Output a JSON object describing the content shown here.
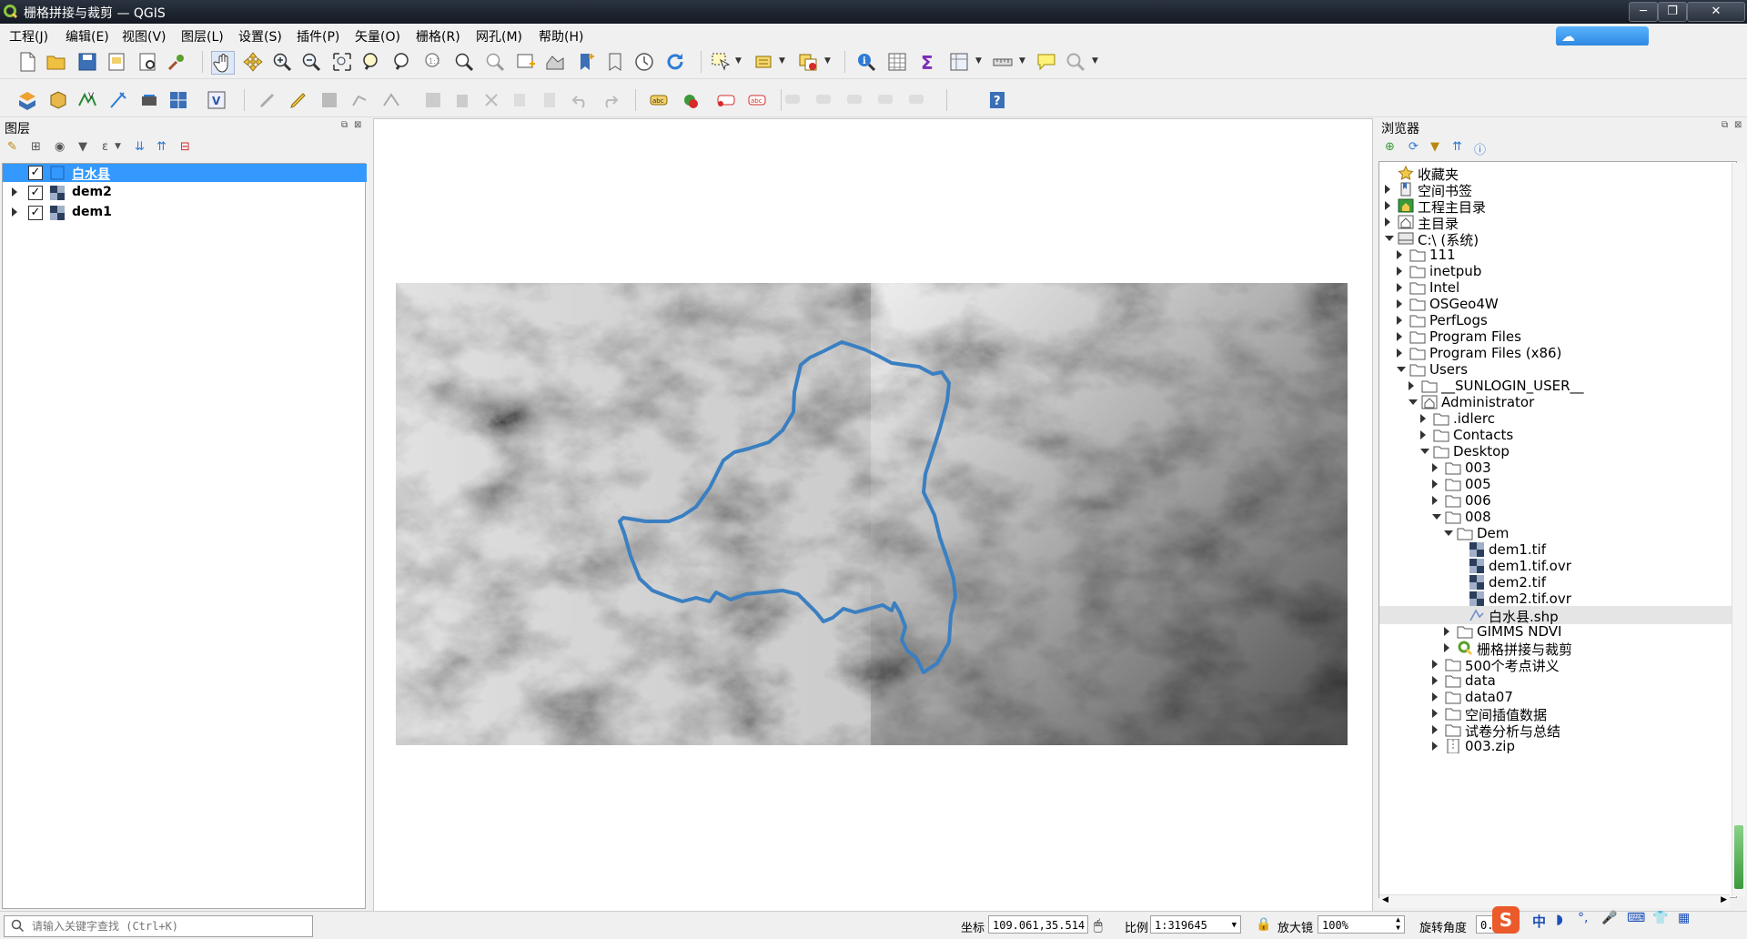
{
  "window": {
    "title": "栅格拼接与裁剪 — QGIS",
    "min": "─",
    "max": "❐",
    "close": "✕"
  },
  "menu": [
    "工程(J)",
    "编辑(E)",
    "视图(V)",
    "图层(L)",
    "设置(S)",
    "插件(P)",
    "矢量(O)",
    "栅格(R)",
    "网孔(M)",
    "帮助(H)"
  ],
  "layers_panel": {
    "title": "图层",
    "layers": [
      {
        "name": "白水县",
        "checked": true,
        "selected": true,
        "type": "vector-polygon"
      },
      {
        "name": "dem2",
        "checked": true,
        "selected": false,
        "type": "raster"
      },
      {
        "name": "dem1",
        "checked": true,
        "selected": false,
        "type": "raster"
      }
    ]
  },
  "browser_panel": {
    "title": "浏览器",
    "items": [
      {
        "label": "收藏夹",
        "depth": 0,
        "exp": "none",
        "icon": "star"
      },
      {
        "label": "空间书签",
        "depth": 0,
        "exp": "closed",
        "icon": "bookmark"
      },
      {
        "label": "工程主目录",
        "depth": 0,
        "exp": "closed",
        "icon": "project-home"
      },
      {
        "label": "主目录",
        "depth": 0,
        "exp": "closed",
        "icon": "home"
      },
      {
        "label": "C:\\ (系统)",
        "depth": 0,
        "exp": "open",
        "icon": "drive"
      },
      {
        "label": "111",
        "depth": 1,
        "exp": "closed",
        "icon": "folder"
      },
      {
        "label": "inetpub",
        "depth": 1,
        "exp": "closed",
        "icon": "folder"
      },
      {
        "label": "Intel",
        "depth": 1,
        "exp": "closed",
        "icon": "folder"
      },
      {
        "label": "OSGeo4W",
        "depth": 1,
        "exp": "closed",
        "icon": "folder"
      },
      {
        "label": "PerfLogs",
        "depth": 1,
        "exp": "closed",
        "icon": "folder"
      },
      {
        "label": "Program Files",
        "depth": 1,
        "exp": "closed",
        "icon": "folder"
      },
      {
        "label": "Program Files (x86)",
        "depth": 1,
        "exp": "closed",
        "icon": "folder"
      },
      {
        "label": "Users",
        "depth": 1,
        "exp": "open",
        "icon": "folder"
      },
      {
        "label": "__SUNLOGIN_USER__",
        "depth": 2,
        "exp": "closed",
        "icon": "folder"
      },
      {
        "label": "Administrator",
        "depth": 2,
        "exp": "open",
        "icon": "home"
      },
      {
        "label": ".idlerc",
        "depth": 3,
        "exp": "closed",
        "icon": "folder"
      },
      {
        "label": "Contacts",
        "depth": 3,
        "exp": "closed",
        "icon": "folder"
      },
      {
        "label": "Desktop",
        "depth": 3,
        "exp": "open",
        "icon": "folder"
      },
      {
        "label": "003",
        "depth": 4,
        "exp": "closed",
        "icon": "folder"
      },
      {
        "label": "005",
        "depth": 4,
        "exp": "closed",
        "icon": "folder"
      },
      {
        "label": "006",
        "depth": 4,
        "exp": "closed",
        "icon": "folder"
      },
      {
        "label": "008",
        "depth": 4,
        "exp": "open",
        "icon": "folder"
      },
      {
        "label": "Dem",
        "depth": 5,
        "exp": "open",
        "icon": "folder"
      },
      {
        "label": "dem1.tif",
        "depth": 6,
        "exp": "none",
        "icon": "raster"
      },
      {
        "label": "dem1.tif.ovr",
        "depth": 6,
        "exp": "none",
        "icon": "raster"
      },
      {
        "label": "dem2.tif",
        "depth": 6,
        "exp": "none",
        "icon": "raster"
      },
      {
        "label": "dem2.tif.ovr",
        "depth": 6,
        "exp": "none",
        "icon": "raster"
      },
      {
        "label": "白水县.shp",
        "depth": 6,
        "exp": "none",
        "icon": "vector",
        "highlight": true
      },
      {
        "label": "GIMMS NDVI",
        "depth": 5,
        "exp": "closed",
        "icon": "folder"
      },
      {
        "label": "栅格拼接与裁剪",
        "depth": 5,
        "exp": "closed",
        "icon": "qgis"
      },
      {
        "label": "500个考点讲义",
        "depth": 4,
        "exp": "closed",
        "icon": "folder"
      },
      {
        "label": "data",
        "depth": 4,
        "exp": "closed",
        "icon": "folder"
      },
      {
        "label": "data07",
        "depth": 4,
        "exp": "closed",
        "icon": "folder"
      },
      {
        "label": "空间插值数据",
        "depth": 4,
        "exp": "closed",
        "icon": "folder"
      },
      {
        "label": "试卷分析与总结",
        "depth": 4,
        "exp": "closed",
        "icon": "folder"
      },
      {
        "label": "003.zip",
        "depth": 4,
        "exp": "closed",
        "icon": "zip"
      }
    ]
  },
  "status": {
    "locator_placeholder": "请输入关键字查找 (Ctrl+K)",
    "coord_label": "坐标",
    "coord_value": "109.061,35.514",
    "scale_label": "比例",
    "scale_value": "1:319645",
    "magnifier_label": "放大镜",
    "magnifier_value": "100%",
    "rotation_label": "旋转角度",
    "rotation_value": "0.",
    "ime_label": "中"
  },
  "colors": {
    "selection": "#3399ff",
    "boundary": "#3a7fc1",
    "accent_qq": "#2d86e0"
  }
}
